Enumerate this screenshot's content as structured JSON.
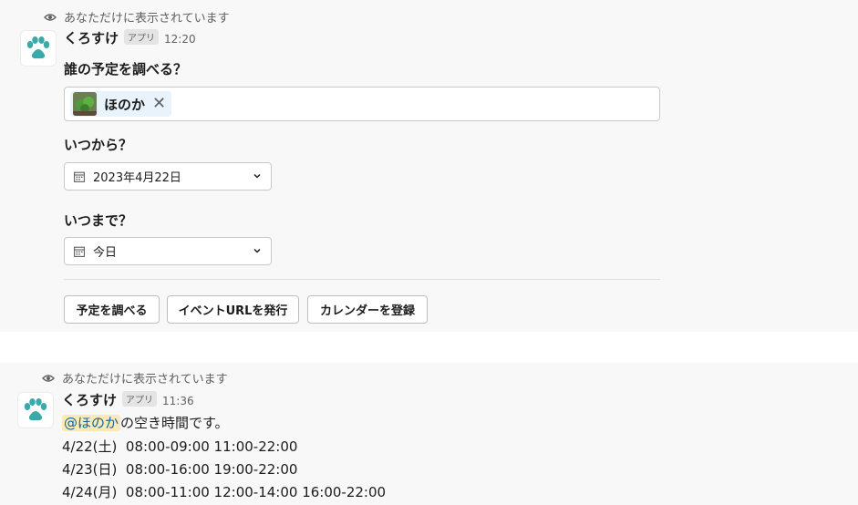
{
  "message1": {
    "ephemeral_note": "あなただけに表示されています",
    "sender": "くろすけ",
    "badge": "アプリ",
    "time": "12:20",
    "form": {
      "who_label": "誰の予定を調べる？",
      "selected_user": "ほのか",
      "from_label": "いつから？",
      "from_value": "2023年4月22日",
      "until_label": "いつまで？",
      "until_value": "今日"
    },
    "buttons": {
      "check_schedule": "予定を調べる",
      "issue_event_url": "イベントURLを発行",
      "register_calendar": "カレンダーを登録"
    }
  },
  "message2": {
    "ephemeral_note": "あなただけに表示されています",
    "sender": "くろすけ",
    "badge": "アプリ",
    "time": "11:36",
    "mention": "@ほのか",
    "intro_suffix": "の空き時間です。",
    "lines": [
      "4/22(土)  08:00-09:00 11:00-22:00",
      "4/23(日)  08:00-16:00 19:00-22:00",
      "4/24(月)  08:00-11:00 12:00-14:00 16:00-22:00"
    ]
  },
  "colors": {
    "background": "#f8f8f8",
    "chip_bg": "#e8f3fb",
    "mention_bg": "#fbe9b6",
    "mention_text": "#1264a3",
    "paw_teal": "#3aa9a9"
  },
  "icons": [
    "eye-icon",
    "paw-icon",
    "calendar-icon",
    "chevron-down-icon",
    "close-icon"
  ]
}
